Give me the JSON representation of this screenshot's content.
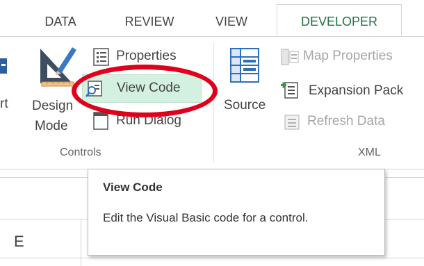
{
  "tabs": [
    {
      "label": "DATA"
    },
    {
      "label": "REVIEW"
    },
    {
      "label": "VIEW"
    },
    {
      "label": "DEVELOPER",
      "active": true
    }
  ],
  "ribbon": {
    "partial_left_label": "rt",
    "controls": {
      "design_mode_line1": "Design",
      "design_mode_line2": "Mode",
      "properties": "Properties",
      "view_code": "View Code",
      "run_dialog": "Run Dialog",
      "group_label": "Controls"
    },
    "xml": {
      "source": "Source",
      "map_properties": "Map Properties",
      "expansion_packs": "Expansion Pack",
      "refresh_data": "Refresh Data",
      "group_label": "XML"
    }
  },
  "tooltip": {
    "title": "View Code",
    "description": "Edit the Visual Basic code for a control."
  },
  "sheet": {
    "column_header": "E"
  },
  "colors": {
    "accent": "#217346",
    "highlight": "#d3f0e0",
    "annotation_ring": "#e0001b",
    "disabled_text": "#a6a6a6"
  }
}
